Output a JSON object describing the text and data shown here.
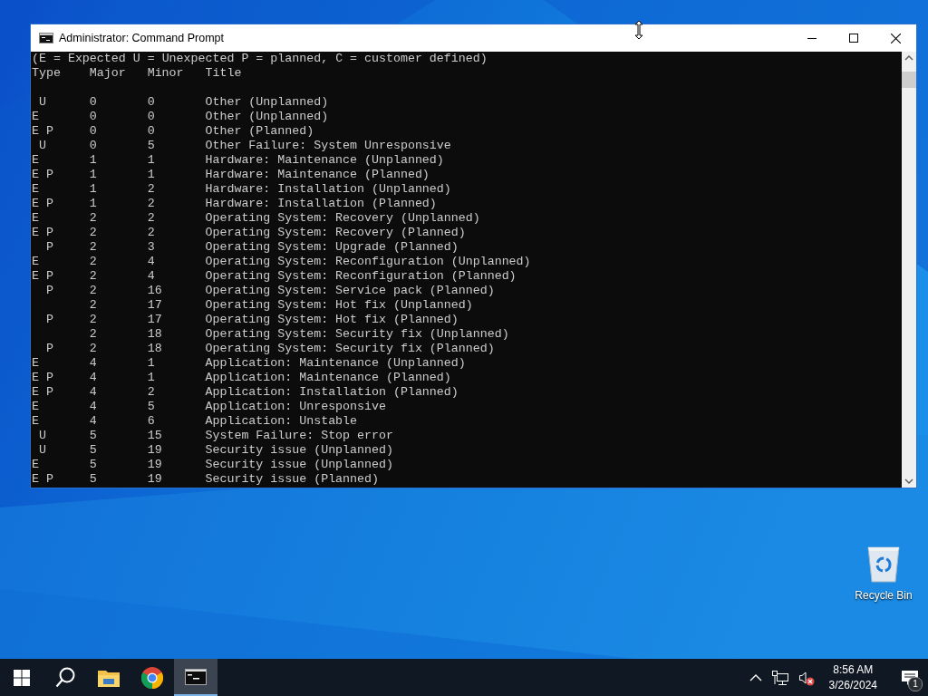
{
  "window": {
    "title": "Administrator: Command Prompt",
    "controls": [
      {
        "kind": "minimize"
      },
      {
        "kind": "maximize"
      },
      {
        "kind": "close"
      }
    ]
  },
  "console": {
    "legend": "(E = Expected U = Unexpected P = planned, C = customer defined)",
    "columns": [
      "Type",
      "Major",
      "Minor",
      "Title"
    ],
    "rows": [
      {
        "type": " U",
        "major": "0",
        "minor": "0",
        "title": "Other (Unplanned)"
      },
      {
        "type": "E",
        "major": "0",
        "minor": "0",
        "title": "Other (Unplanned)"
      },
      {
        "type": "E P",
        "major": "0",
        "minor": "0",
        "title": "Other (Planned)"
      },
      {
        "type": " U",
        "major": "0",
        "minor": "5",
        "title": "Other Failure: System Unresponsive"
      },
      {
        "type": "E",
        "major": "1",
        "minor": "1",
        "title": "Hardware: Maintenance (Unplanned)"
      },
      {
        "type": "E P",
        "major": "1",
        "minor": "1",
        "title": "Hardware: Maintenance (Planned)"
      },
      {
        "type": "E",
        "major": "1",
        "minor": "2",
        "title": "Hardware: Installation (Unplanned)"
      },
      {
        "type": "E P",
        "major": "1",
        "minor": "2",
        "title": "Hardware: Installation (Planned)"
      },
      {
        "type": "E",
        "major": "2",
        "minor": "2",
        "title": "Operating System: Recovery (Unplanned)"
      },
      {
        "type": "E P",
        "major": "2",
        "minor": "2",
        "title": "Operating System: Recovery (Planned)"
      },
      {
        "type": "  P",
        "major": "2",
        "minor": "3",
        "title": "Operating System: Upgrade (Planned)"
      },
      {
        "type": "E",
        "major": "2",
        "minor": "4",
        "title": "Operating System: Reconfiguration (Unplanned)"
      },
      {
        "type": "E P",
        "major": "2",
        "minor": "4",
        "title": "Operating System: Reconfiguration (Planned)"
      },
      {
        "type": "  P",
        "major": "2",
        "minor": "16",
        "title": "Operating System: Service pack (Planned)"
      },
      {
        "major": "2",
        "minor": "17",
        "title": "Operating System: Hot fix (Unplanned)"
      },
      {
        "type": "  P",
        "major": "2",
        "minor": "17",
        "title": "Operating System: Hot fix (Planned)"
      },
      {
        "major": "2",
        "minor": "18",
        "title": "Operating System: Security fix (Unplanned)"
      },
      {
        "type": "  P",
        "major": "2",
        "minor": "18",
        "title": "Operating System: Security fix (Planned)"
      },
      {
        "type": "E",
        "major": "4",
        "minor": "1",
        "title": "Application: Maintenance (Unplanned)"
      },
      {
        "type": "E P",
        "major": "4",
        "minor": "1",
        "title": "Application: Maintenance (Planned)"
      },
      {
        "type": "E P",
        "major": "4",
        "minor": "2",
        "title": "Application: Installation (Planned)"
      },
      {
        "type": "E",
        "major": "4",
        "minor": "5",
        "title": "Application: Unresponsive"
      },
      {
        "type": "E",
        "major": "4",
        "minor": "6",
        "title": "Application: Unstable"
      },
      {
        "type": " U",
        "major": "5",
        "minor": "15",
        "title": "System Failure: Stop error"
      },
      {
        "type": " U",
        "major": "5",
        "minor": "19",
        "title": "Security issue (Unplanned)"
      },
      {
        "type": "E",
        "major": "5",
        "minor": "19",
        "title": "Security issue (Unplanned)"
      },
      {
        "type": "E P",
        "major": "5",
        "minor": "19",
        "title": "Security issue (Planned)"
      }
    ]
  },
  "desktop_icons": [
    {
      "label": "Recycle Bin"
    }
  ],
  "taskbar": {
    "items": [
      {
        "kind": "start",
        "selected": false
      },
      {
        "kind": "search",
        "selected": false
      },
      {
        "kind": "explorer",
        "selected": false
      },
      {
        "kind": "chrome",
        "selected": false
      },
      {
        "kind": "console",
        "selected": true
      }
    ],
    "tray": {
      "time": "8:56 AM",
      "date": "3/26/2024",
      "notification_count": "1"
    }
  }
}
